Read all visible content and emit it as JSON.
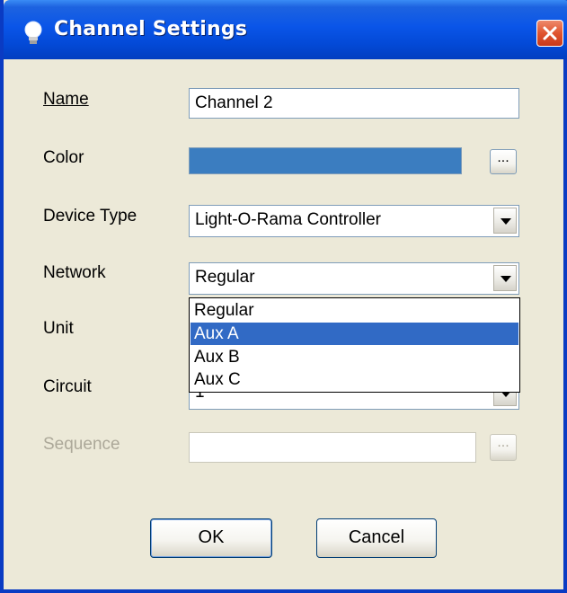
{
  "window": {
    "title": "Channel Settings",
    "icon": "lightbulb-icon",
    "close_icon": "close-icon"
  },
  "fields": {
    "name": {
      "label": "Name",
      "value": "Channel 2"
    },
    "color": {
      "label": "Color",
      "value_color": "#3B7DC0",
      "browse_label": "..."
    },
    "device_type": {
      "label": "Device Type",
      "value": "Light-O-Rama Controller"
    },
    "network": {
      "label": "Network",
      "value": "Regular"
    },
    "unit": {
      "label": "Unit"
    },
    "circuit": {
      "label": "Circuit",
      "value": "1"
    },
    "sequence": {
      "label": "Sequence",
      "value": "",
      "browse_label": "..."
    }
  },
  "network_dropdown": {
    "options": [
      "Regular",
      "Aux A",
      "Aux B",
      "Aux C"
    ],
    "highlighted": "Aux A"
  },
  "buttons": {
    "ok": "OK",
    "cancel": "Cancel"
  },
  "colors": {
    "titlebar": "#0A55E8",
    "selection": "#316AC5",
    "dialog_bg": "#ECE9D8"
  }
}
